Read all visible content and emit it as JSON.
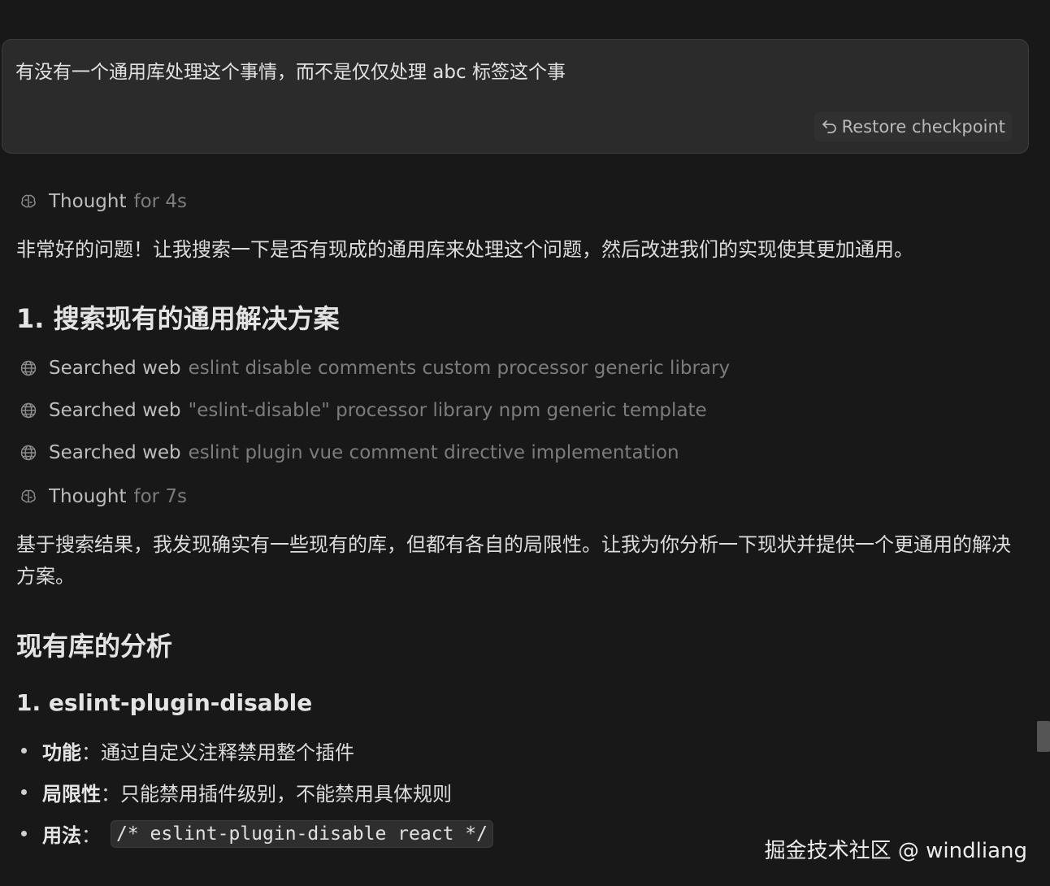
{
  "user_message": {
    "text": "有没有一个通用库处理这个事情，而不是仅仅处理 abc 标签这个事",
    "restore_label": "Restore checkpoint"
  },
  "thought_1": {
    "label": "Thought",
    "detail": "for 4s"
  },
  "intro": "非常好的问题！让我搜索一下是否有现成的通用库来处理这个问题，然后改进我们的实现使其更加通用。",
  "section1_heading": "1. 搜索现有的通用解决方案",
  "searches": [
    {
      "label": "Searched web",
      "query": "eslint disable comments custom processor generic library"
    },
    {
      "label": "Searched web",
      "query": "\"eslint-disable\" processor library npm generic template"
    },
    {
      "label": "Searched web",
      "query": "eslint plugin vue comment directive implementation"
    }
  ],
  "thought_2": {
    "label": "Thought",
    "detail": "for 7s"
  },
  "summary": "基于搜索结果，我发现确实有一些现有的库，但都有各自的局限性。让我为你分析一下现状并提供一个更通用的解决方案。",
  "analysis_heading": "现有库的分析",
  "lib1_heading": "1. eslint-plugin-disable",
  "bullets": [
    {
      "label": "功能",
      "sep": "：",
      "text": "通过自定义注释禁用整个插件"
    },
    {
      "label": "局限性",
      "sep": "：",
      "text": "只能禁用插件级别，不能禁用具体规则"
    },
    {
      "label": "用法",
      "sep": "：",
      "code": "/* eslint-plugin-disable react */"
    }
  ],
  "watermark": "掘金技术社区 @ windliang",
  "icons": {
    "thought": "brain-icon",
    "search": "globe-icon",
    "restore": "undo-arrow-icon"
  },
  "colors": {
    "background": "#181818",
    "user_bubble": "#2b2b2b",
    "muted_text": "#7c7c7c"
  }
}
